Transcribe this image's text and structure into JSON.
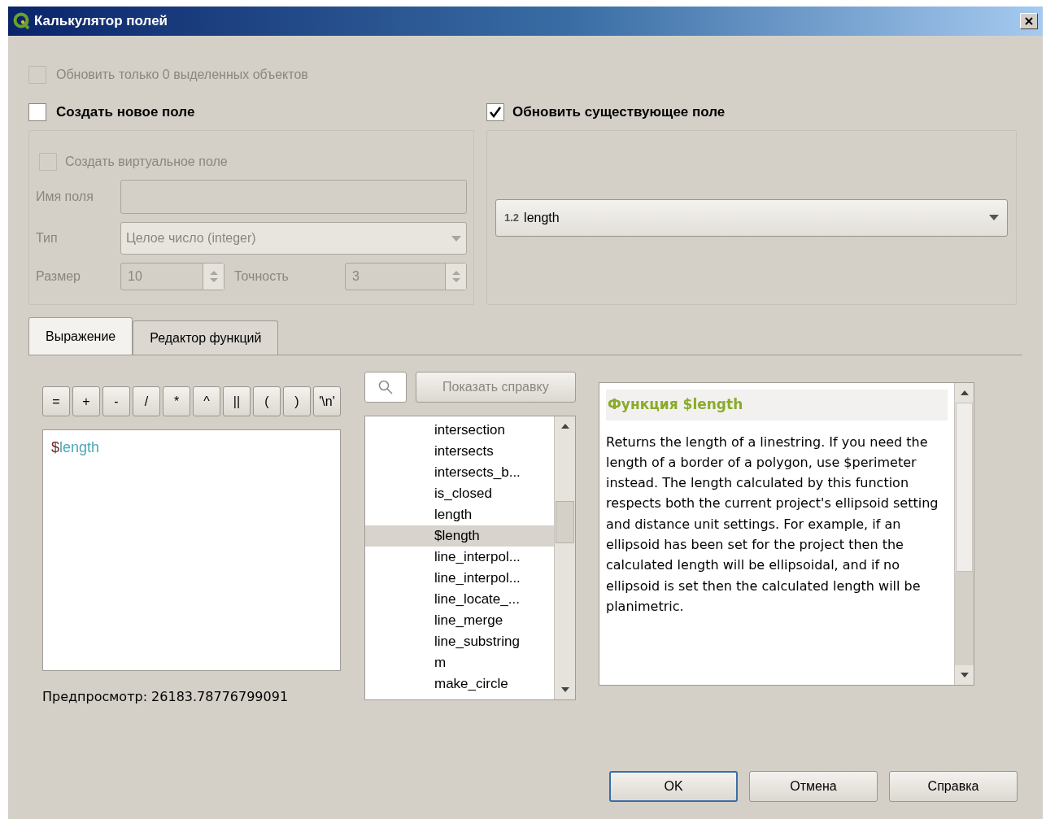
{
  "window": {
    "title": "Калькулятор полей"
  },
  "only_selected": {
    "label": "Обновить только 0 выделенных объектов",
    "checked": false,
    "disabled": true
  },
  "create_new": {
    "label": "Создать новое поле",
    "checked": false,
    "virtual": {
      "label": "Создать виртуальное поле",
      "checked": false
    },
    "name_label": "Имя поля",
    "type_label": "Тип",
    "type_value": "Целое число (integer)",
    "size_label": "Размер",
    "size_value": "10",
    "precision_label": "Точность",
    "precision_value": "3",
    "disabled": true
  },
  "update_existing": {
    "label": "Обновить существующее поле",
    "checked": true,
    "field_type": "1.2",
    "field": "length"
  },
  "tabs": [
    {
      "label": "Выражение",
      "selected": true
    },
    {
      "label": "Редактор функций",
      "selected": false
    }
  ],
  "operators": [
    "=",
    "+",
    "-",
    "/",
    "*",
    "^",
    "||",
    "(",
    ")",
    "'\\n'"
  ],
  "expression": {
    "prefix": "$",
    "name": "length"
  },
  "preview": "Предпросмотр: 26183.78776799091",
  "show_help": "Показать справку",
  "functions": [
    {
      "label": "intersection",
      "selected": false
    },
    {
      "label": "intersects",
      "selected": false
    },
    {
      "label": "intersects_b...",
      "selected": false
    },
    {
      "label": "is_closed",
      "selected": false
    },
    {
      "label": "length",
      "selected": false
    },
    {
      "label": "$length",
      "selected": true
    },
    {
      "label": "line_interpol...",
      "selected": false
    },
    {
      "label": "line_interpol...",
      "selected": false
    },
    {
      "label": "line_locate_...",
      "selected": false
    },
    {
      "label": "line_merge",
      "selected": false
    },
    {
      "label": "line_substring",
      "selected": false
    },
    {
      "label": "m",
      "selected": false
    },
    {
      "label": "make_circle",
      "selected": false
    }
  ],
  "help": {
    "title": "Функция $length",
    "text": "Returns the length of a linestring. If you need the length of a border of a polygon, use $perimeter instead. The length calculated by this function respects both the current project's ellipsoid setting and distance unit settings. For example, if an ellipsoid has been set for the project then the calculated length will be ellipsoidal, and if no ellipsoid is set then the calculated length will be planimetric."
  },
  "buttons": [
    {
      "label": "OK",
      "selected": true
    },
    {
      "label": "Отмена",
      "selected": false
    },
    {
      "label": "Справка",
      "selected": false
    }
  ]
}
